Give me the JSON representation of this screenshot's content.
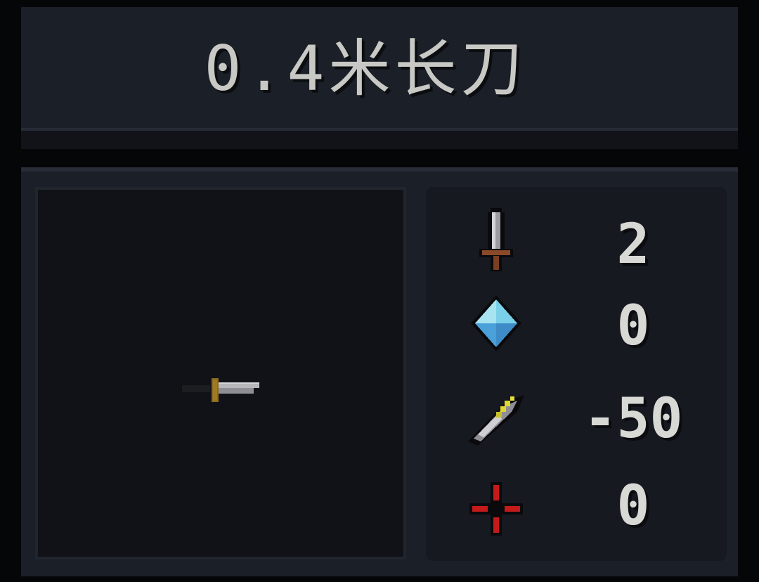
{
  "item": {
    "name": "0.4米长刀",
    "preview_icon": "knife-icon"
  },
  "stats": [
    {
      "icon": "sword-icon",
      "label": "attack",
      "value": "2"
    },
    {
      "icon": "crystal-icon",
      "label": "energy",
      "value": "0"
    },
    {
      "icon": "feather-icon",
      "label": "speed",
      "value": "-50"
    },
    {
      "icon": "crosshair-icon",
      "label": "critical",
      "value": "0"
    }
  ],
  "colors": {
    "panel": "#1b1f28",
    "preview_bg": "#101217",
    "text": "#d8d8d4",
    "crystal": "#5ab8d8",
    "crosshair": "#c41a1a",
    "feather_accent": "#d8d030"
  }
}
